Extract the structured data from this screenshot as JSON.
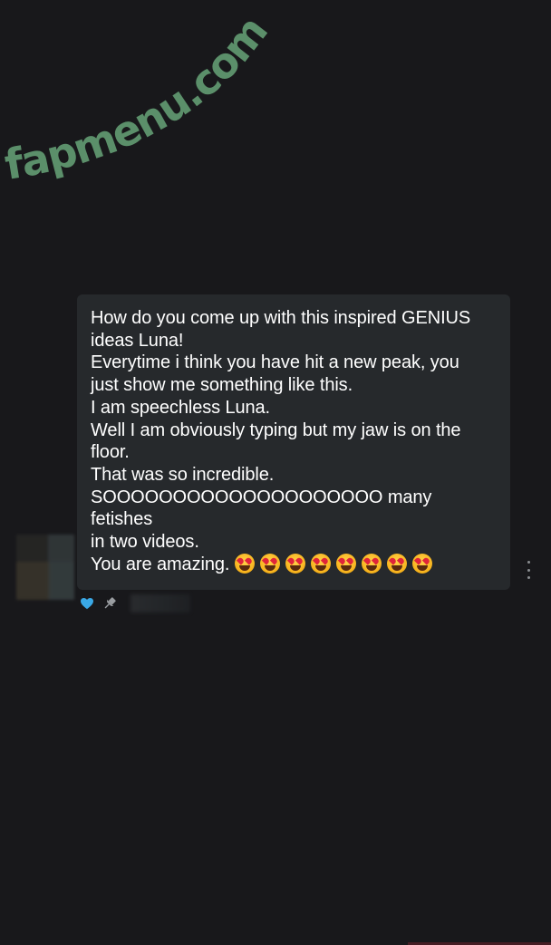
{
  "watermark": {
    "text": "fapmenu.com",
    "color": "#5b8f6a"
  },
  "message": {
    "lines": [
      "How do you come up with this inspired GENIUS",
      "ideas Luna!",
      "Everytime i think you have hit a new peak, you",
      "just show me something like this.",
      "I am speechless Luna.",
      "Well I am obviously typing but my jaw is on the",
      "floor.",
      "That was so incredible.",
      "SOOOOOOOOOOOOOOOOOOOO many fetishes",
      "in two videos.",
      "You are amazing."
    ],
    "emoji_name": "star-struck-emoji",
    "emoji_count": 8
  },
  "colors": {
    "background": "#18181b",
    "bubble": "#26292c",
    "text": "#ffffff",
    "heart": "#3aa8e6",
    "icon_gray": "#9a9da1"
  },
  "icons": {
    "like": "heart-icon",
    "pin": "pin-icon",
    "more": "more-vertical-icon"
  }
}
